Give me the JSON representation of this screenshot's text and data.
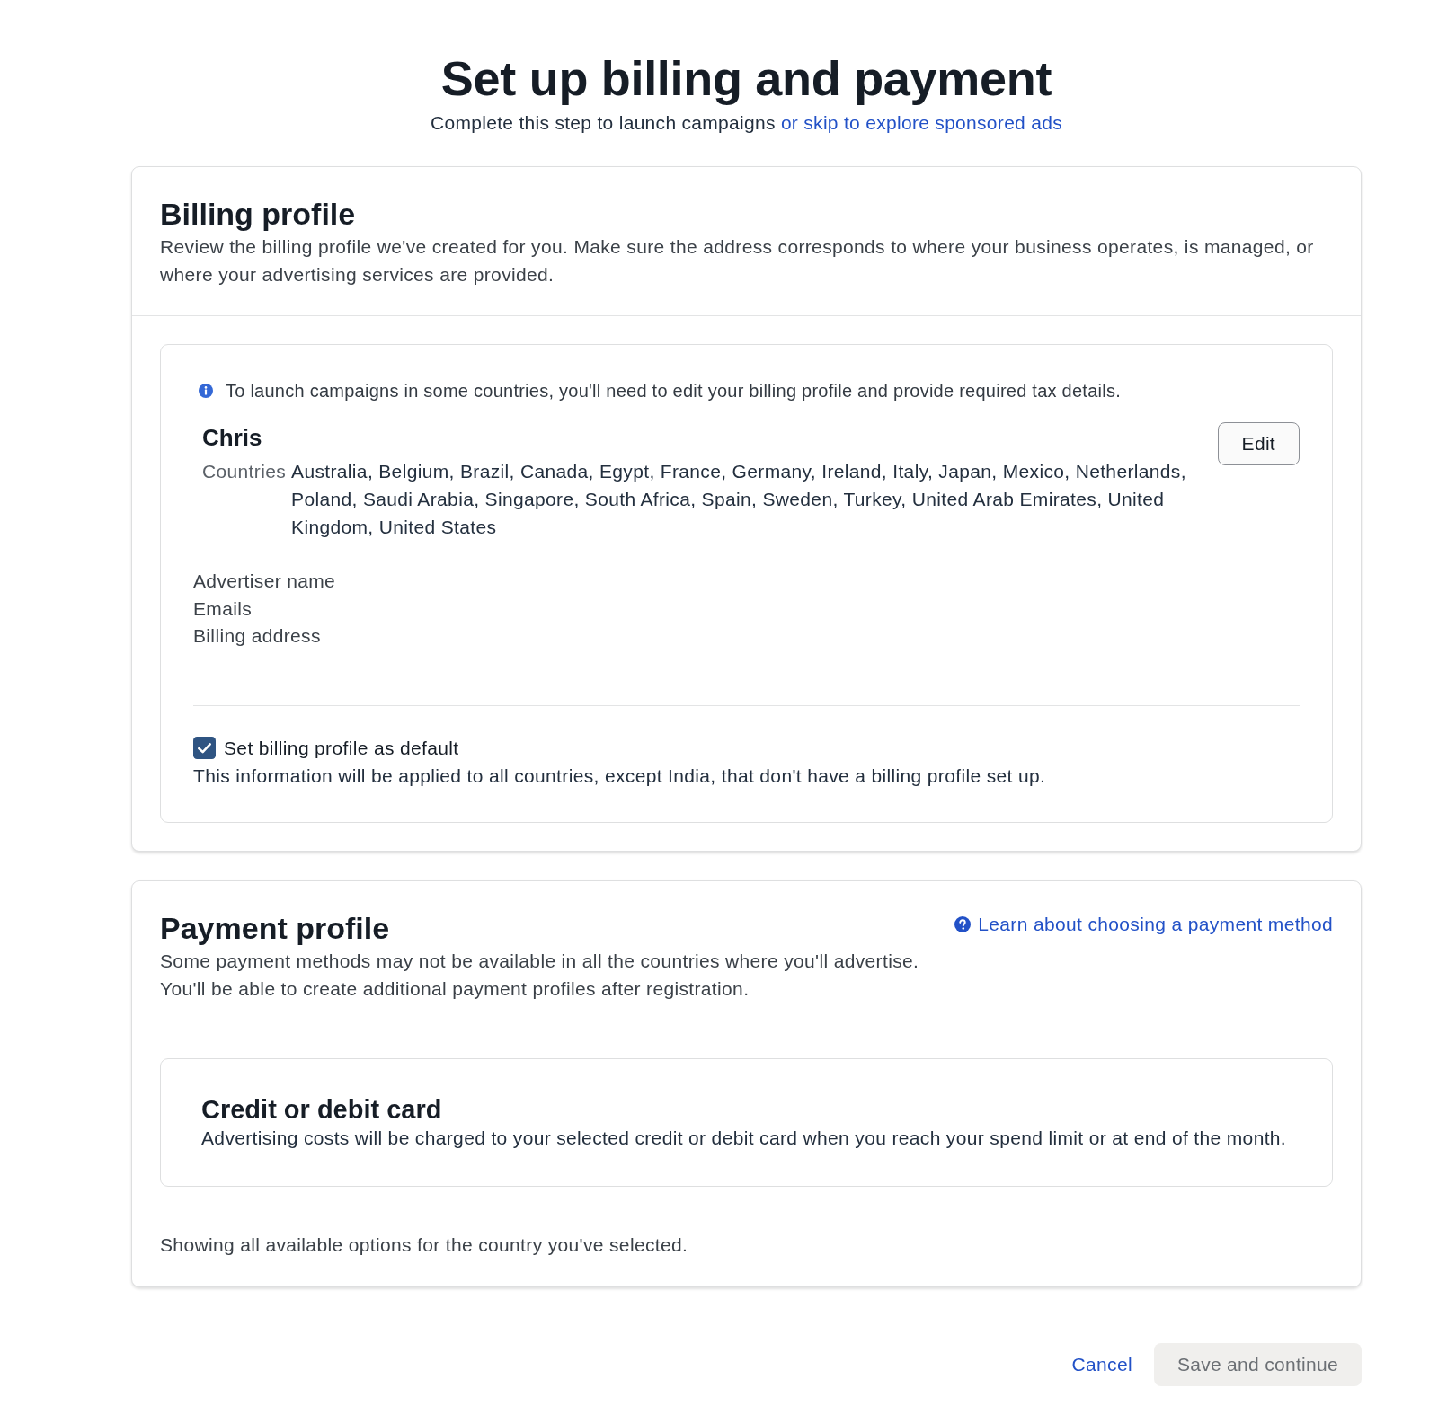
{
  "page": {
    "title": "Set up billing and payment",
    "subtitle": "Complete this step to launch campaigns",
    "subtitle_link": "or skip to explore sponsored ads"
  },
  "billing_profile": {
    "heading": "Billing profile",
    "description": "Review the billing profile we've created for you. Make sure the address corresponds to where your business operates, is managed, or where your advertising services are provided.",
    "notice": "To launch campaigns in some countries, you'll need to edit your billing profile and provide required tax details.",
    "profile": {
      "name": "Chris",
      "countries_label": "Countries",
      "countries": "Australia, Belgium, Brazil, Canada, Egypt, France, Germany, Ireland, Italy, Japan, Mexico, Netherlands, Poland, Saudi Arabia, Singapore, South Africa, Spain, Sweden, Turkey, United Arab Emirates, United Kingdom, United States",
      "edit_button": "Edit",
      "fields": [
        "Advertiser name",
        "Emails",
        "Billing address"
      ]
    },
    "default_checkbox": {
      "label": "Set billing profile as default",
      "checked": true
    },
    "default_note": "This information will be applied to all countries, except India, that don't have a billing profile set up."
  },
  "payment_profile": {
    "heading": "Payment profile",
    "help_link": "Learn about choosing a payment method",
    "description_lines": [
      "Some payment methods may not be available in all the countries where you'll advertise.",
      "You'll be able to create additional payment profiles after registration."
    ],
    "methods": [
      {
        "title": "Credit or debit card",
        "description": "Advertising costs will be charged to your selected credit or debit card when you reach your spend limit or at end of the month."
      }
    ],
    "footer_note": "Showing all available options for the country you've selected."
  },
  "actions": {
    "cancel": "Cancel",
    "save": {
      "label": "Save and continue",
      "disabled": true
    }
  }
}
